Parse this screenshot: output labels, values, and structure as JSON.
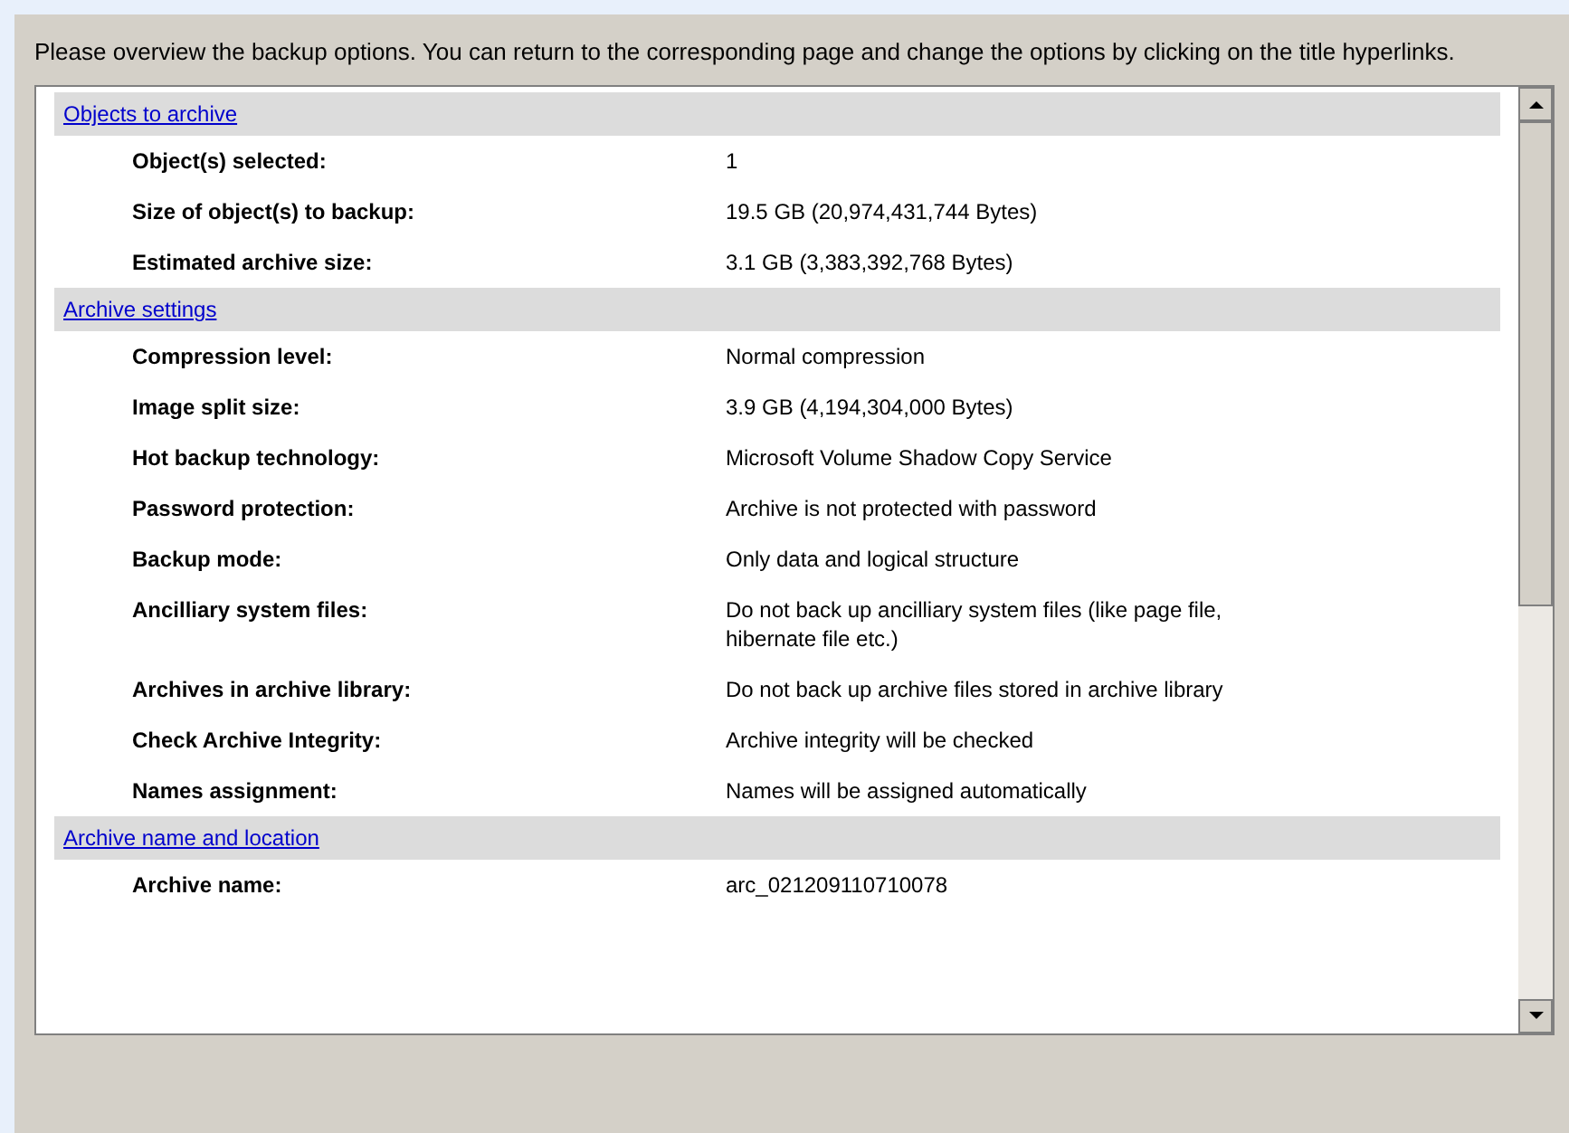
{
  "intro": "Please overview the backup options. You can return to the corresponding page and change the options by clicking on the title hyperlinks.",
  "sections": [
    {
      "title": "Objects to archive",
      "rows": [
        {
          "label": "Object(s) selected:",
          "value": "1"
        },
        {
          "label": "Size of object(s) to backup:",
          "value": "19.5 GB (20,974,431,744 Bytes)"
        },
        {
          "label": "Estimated archive size:",
          "value": "3.1 GB (3,383,392,768 Bytes)"
        }
      ]
    },
    {
      "title": "Archive settings",
      "rows": [
        {
          "label": "Compression level:",
          "value": "Normal compression"
        },
        {
          "label": "Image split size:",
          "value": "3.9 GB (4,194,304,000 Bytes)"
        },
        {
          "label": "Hot backup technology:",
          "value": "Microsoft Volume Shadow Copy Service"
        },
        {
          "label": "Password protection:",
          "value": "Archive is not protected with password"
        },
        {
          "label": "Backup mode:",
          "value": "Only data and logical structure"
        },
        {
          "label": "Ancilliary system files:",
          "value": "Do not back up ancilliary system files (like page file, hibernate file etc.)"
        },
        {
          "label": "Archives in archive library:",
          "value": "Do not back up archive files stored in archive library"
        },
        {
          "label": "Check Archive Integrity:",
          "value": "Archive integrity will be checked"
        },
        {
          "label": "Names assignment:",
          "value": "Names will be assigned automatically"
        }
      ]
    },
    {
      "title": "Archive name and location",
      "rows": [
        {
          "label": "Archive name:",
          "value": "arc_021209110710078"
        }
      ]
    }
  ]
}
